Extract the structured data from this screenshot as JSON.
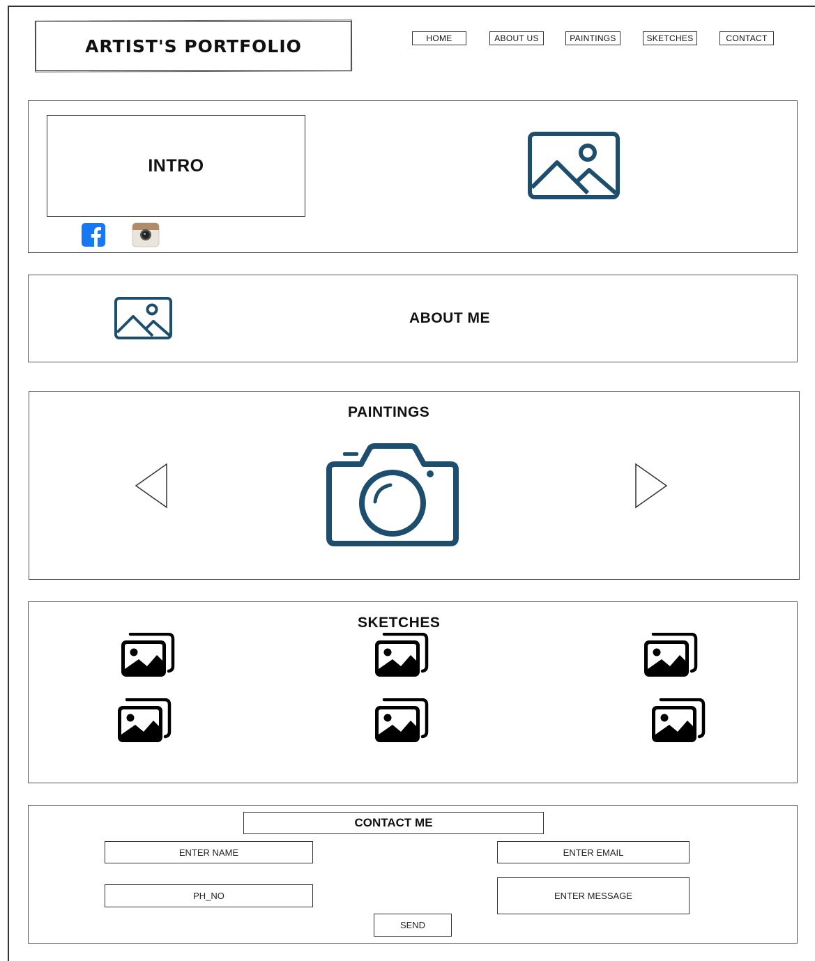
{
  "header": {
    "logo_text": "ARTIST'S PORTFOLIO",
    "nav": [
      "HOME",
      "ABOUT US",
      "PAINTINGS",
      "SKETCHES",
      "CONTACT"
    ]
  },
  "intro": {
    "title": "INTRO",
    "social_icons": [
      "facebook-icon",
      "instagram-icon"
    ],
    "image_icon": "image-placeholder-icon"
  },
  "about": {
    "title": "ABOUT ME",
    "image_icon": "image-placeholder-icon"
  },
  "paintings": {
    "title": "PAINTINGS",
    "carousel_icon": "camera-icon",
    "prev_icon": "chevron-left-icon",
    "next_icon": "chevron-right-icon"
  },
  "sketches": {
    "title": "SKETCHES",
    "items_icon": "image-gallery-icon",
    "count": 6
  },
  "contact": {
    "title": "CONTACT ME",
    "name_placeholder": "ENTER NAME",
    "email_placeholder": "ENTER EMAIL",
    "phone_placeholder": "PH_NO",
    "message_placeholder": "ENTER MESSAGE",
    "send_label": "SEND"
  },
  "colors": {
    "icon_blue": "#1d4e6e",
    "facebook_blue": "#1877f2",
    "border": "#333333"
  }
}
